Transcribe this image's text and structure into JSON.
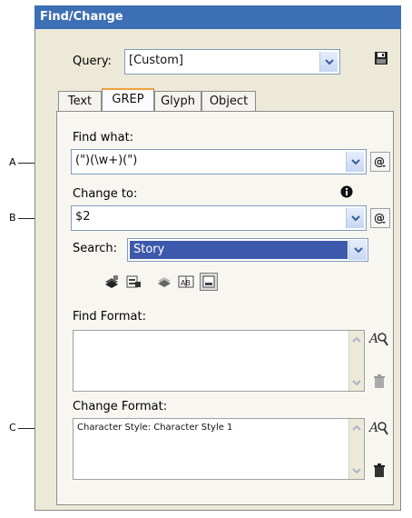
{
  "window": {
    "title": "Find/Change"
  },
  "query": {
    "label": "Query:",
    "value": "[Custom]"
  },
  "tabs": [
    {
      "label": "Text"
    },
    {
      "label": "GREP"
    },
    {
      "label": "Glyph"
    },
    {
      "label": "Object"
    }
  ],
  "find_what": {
    "label": "Find what:",
    "value": "(\")(\\w+)(\")"
  },
  "change_to": {
    "label": "Change to:",
    "value": "$2"
  },
  "search": {
    "label": "Search:",
    "value": "Story"
  },
  "find_format": {
    "label": "Find Format:",
    "value": ""
  },
  "change_format": {
    "label": "Change Format:",
    "value": "Character Style: Character Style 1"
  },
  "callouts": {
    "a": "A",
    "b": "B",
    "c": "C"
  },
  "colors": {
    "title_bar": "#3d6fb4",
    "search_highlight": "#3d59ab",
    "active_tab_accent": "#f2a03b"
  },
  "icons": [
    "save-query-icon",
    "chevron-down-icon",
    "special-characters-icon",
    "info-icon",
    "include-locked-layers-icon",
    "include-locked-stories-icon",
    "include-hidden-layers-icon",
    "include-master-pages-icon",
    "include-footnotes-icon",
    "specify-attributes-icon",
    "clear-attributes-icon"
  ]
}
